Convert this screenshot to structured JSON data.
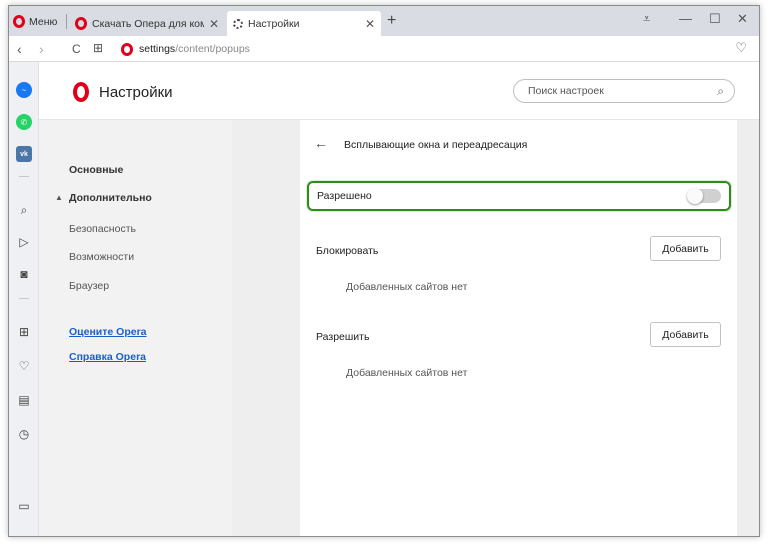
{
  "tabbar": {
    "menu_label": "Меню",
    "tabs": [
      {
        "title": "Скачать Опера для компь",
        "close": "✕"
      },
      {
        "title": "Настройки",
        "close": "✕"
      }
    ],
    "new_tab": "+",
    "controls": {
      "tab_menu": "⩡",
      "minimize": "—",
      "maximize": "☐",
      "close": "✕"
    }
  },
  "addressbar": {
    "back": "‹",
    "forward": "›",
    "reload": "C",
    "speed_dial": "⊞",
    "url_strong": "settings",
    "url_dim": "/content/popups",
    "heart": "♡"
  },
  "sidebar": {
    "messenger_glyph": "~",
    "whatsapp_glyph": "✆",
    "vk_glyph": "vk",
    "search_glyph": "⌕",
    "send_glyph": "▷",
    "camera_glyph": "◙",
    "apps_glyph": "⊞",
    "heart_glyph": "♡",
    "news_glyph": "▤",
    "history_glyph": "◷",
    "panel_glyph": "▭"
  },
  "header": {
    "title": "Настройки",
    "search_placeholder": "Поиск настроек",
    "search_icon": "⌕"
  },
  "settings_nav": {
    "basic": "Основные",
    "advanced": "Дополнительно",
    "advanced_caret": "▲",
    "security": "Безопасность",
    "features": "Возможности",
    "browser": "Браузер",
    "rate_link": "Оцените Opera",
    "help_link": "Справка Opera"
  },
  "panel": {
    "back_arrow": "←",
    "title": "Всплывающие окна и переадресация",
    "allowed_label": "Разрешено",
    "allowed_on": false,
    "block": {
      "label": "Блокировать",
      "button": "Добавить",
      "empty": "Добавленных сайтов нет"
    },
    "allow": {
      "label": "Разрешить",
      "button": "Добавить",
      "empty": "Добавленных сайтов нет"
    }
  }
}
